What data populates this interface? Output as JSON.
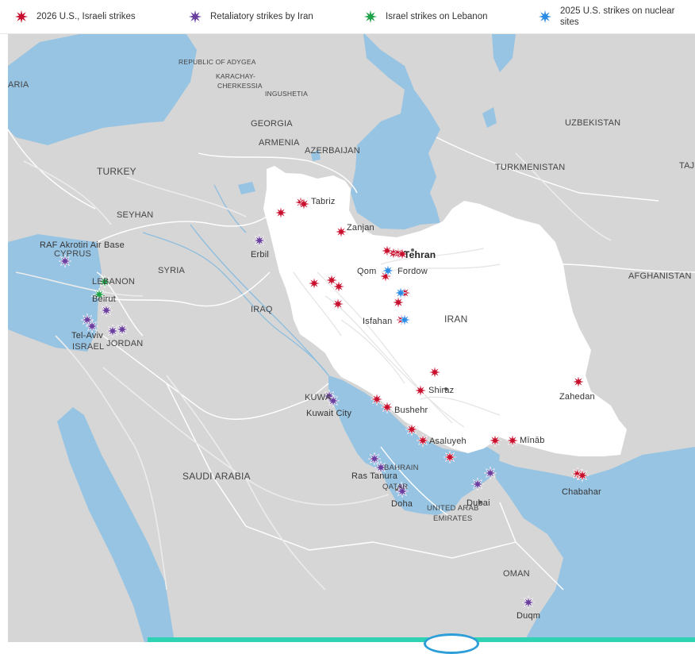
{
  "legend": [
    {
      "label": "2026 U.S., Israeli strikes",
      "color": "#c8102e",
      "icon": "star-burst-icon"
    },
    {
      "label": "Retaliatory strikes by Iran",
      "color": "#6b3fa0",
      "icon": "star-burst-icon"
    },
    {
      "label": "Israel strikes on Lebanon",
      "color": "#1fa34a",
      "icon": "star-burst-icon"
    },
    {
      "label": "2025 U.S. strikes on nuclear sites",
      "color": "#2b8ce6",
      "icon": "star-burst-icon"
    }
  ],
  "colors": {
    "water": "#97c4e3",
    "land": "#d6d6d6",
    "iran": "#ffffff",
    "border": "#ffffff"
  },
  "map": {
    "labels": {
      "aria": "ARIA",
      "adygea": "REPUBLIC OF ADYGEA",
      "karachay": "KARACHAY-",
      "cherkessia": "CHERKESSIA",
      "ingushetia": "INGUSHETIA",
      "georgia": "GEORGIA",
      "armenia": "ARMENIA",
      "azerbaijan": "AZERBAIJAN",
      "uzbekistan": "UZBEKISTAN",
      "turkmenistan": "TURKMENISTAN",
      "taj": "TAJ",
      "turkey": "TURKEY",
      "seyhan": "SEYHAN",
      "raf": "RAF Akrotiri Air Base",
      "cyprus": "CYPRUS",
      "syria": "SYRIA",
      "lebanon": "LEBANON",
      "beirut": "Beirut",
      "telaviv": "Tel-Aviv",
      "israel": "ISRAEL",
      "jordan": "JORDAN",
      "iraq": "IRAQ",
      "erbil": "Erbil",
      "tabriz": "Tabriz",
      "zanjan": "Zanjan",
      "tehran": "Tehran",
      "qom": "Qom",
      "fordow": "Fordow",
      "isfahan": "Isfahan",
      "iran": "IRAN",
      "afghanistan": "AFGHANISTAN",
      "shiraz": "Shiraz",
      "zahedan": "Zahedan",
      "kuwait": "KUWA",
      "kuwaitcity": "Kuwait City",
      "bushehr": "Bushehr",
      "asaluyeh": "Asaluyeh",
      "minab": "Mīnāb",
      "bahrain": "BAHRAIN",
      "rastanura": "Ras Tanura",
      "qatar": "QATAR",
      "doha": "Doha",
      "saudi": "SAUDI ARABIA",
      "uae1": "UNITED ARAB",
      "uae2": "EMIRATES",
      "dubai": "Dubai",
      "chabahar": "Chabahar",
      "oman": "OMAN",
      "duqm": "Duqm"
    }
  }
}
